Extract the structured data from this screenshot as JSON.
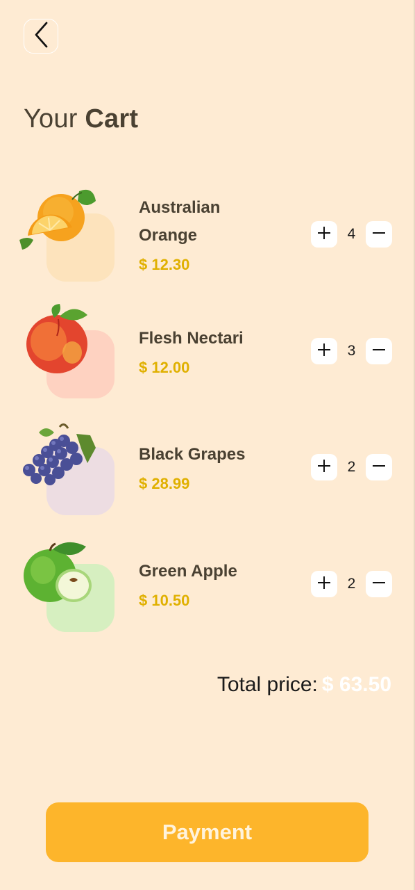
{
  "header": {
    "title_prefix": "Your",
    "title_bold": "Cart",
    "back_icon": "chevron-left-icon"
  },
  "cart": {
    "items": [
      {
        "name": "Australian Orange",
        "price": "$ 12.30",
        "quantity": "4",
        "bg_color": "#FDE3BC",
        "image": "orange-icon"
      },
      {
        "name": "Flesh Nectari",
        "price": "$ 12.00",
        "quantity": "3",
        "bg_color": "#FED2C1",
        "image": "peach-icon"
      },
      {
        "name": "Black Grapes",
        "price": "$ 28.99",
        "quantity": "2",
        "bg_color": "#EDDDE2",
        "image": "grapes-icon"
      },
      {
        "name": "Green Apple",
        "price": "$ 10.50",
        "quantity": "2",
        "bg_color": "#D6EFC0",
        "image": "apple-icon"
      }
    ],
    "plus_icon": "plus-icon",
    "minus_icon": "minus-icon"
  },
  "summary": {
    "total_label": "Total price:",
    "total_value": "$ 63.50"
  },
  "payment_button": {
    "label": "Payment"
  },
  "colors": {
    "background": "#FEEBD3",
    "accent": "#FDB52B",
    "price": "#E0B000",
    "text_dark": "#4A4132"
  }
}
